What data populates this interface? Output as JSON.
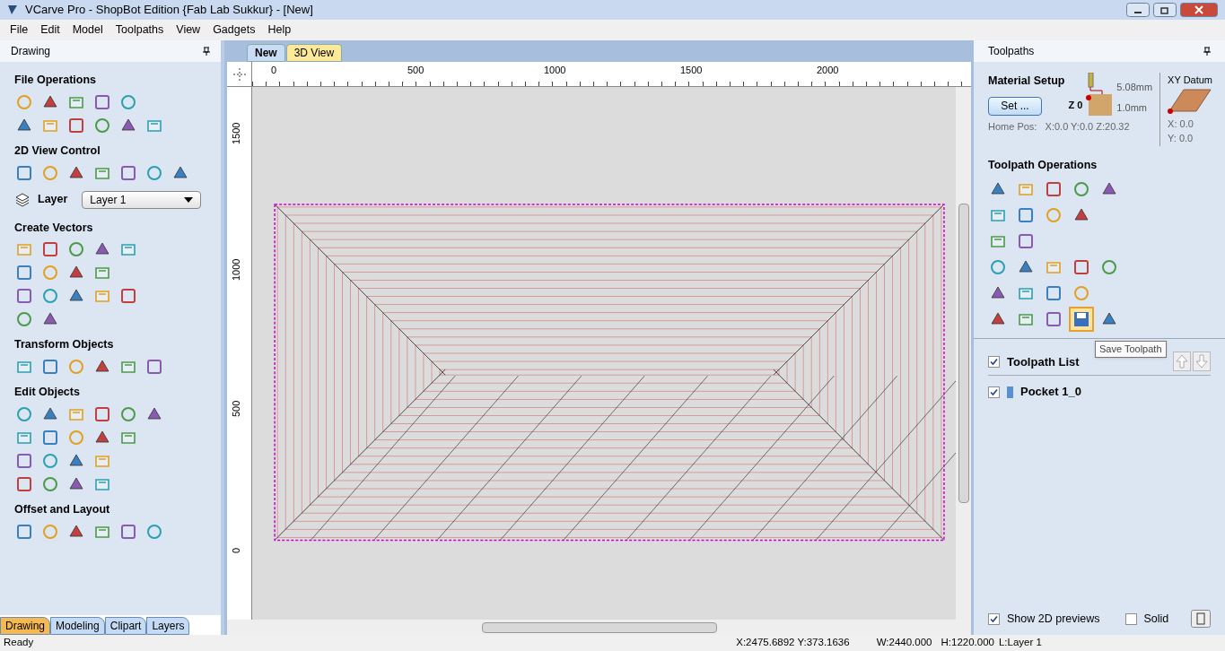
{
  "window": {
    "title": "VCarve Pro - ShopBot Edition {Fab Lab Sukkur} - [New]"
  },
  "menu": [
    "File",
    "Edit",
    "Model",
    "Toolpaths",
    "View",
    "Gadgets",
    "Help"
  ],
  "left_panel": {
    "title": "Drawing",
    "sections": [
      {
        "kind": "icons",
        "title": "File Operations"
      },
      {
        "kind": "icons",
        "title": "2D View Control"
      },
      {
        "kind": "layer",
        "label": "Layer",
        "value": "Layer 1"
      },
      {
        "kind": "icons",
        "title": "Create Vectors"
      },
      {
        "kind": "icons",
        "title": "Transform Objects"
      },
      {
        "kind": "icons",
        "title": "Edit Objects"
      },
      {
        "kind": "icons",
        "title": "Offset and Layout"
      }
    ],
    "tabs": [
      {
        "label": "Drawing",
        "selected": true
      },
      {
        "label": "Modeling",
        "selected": false
      },
      {
        "label": "Clipart",
        "selected": false
      },
      {
        "label": "Layers",
        "selected": false
      }
    ]
  },
  "view_tabs": [
    {
      "label": "New",
      "selected": true
    },
    {
      "label": "3D View",
      "selected": false
    }
  ],
  "ruler": {
    "x_labels": [
      "0",
      "500",
      "1000",
      "1500",
      "2000"
    ],
    "y_labels": [
      "1500",
      "1000",
      "500",
      "0"
    ]
  },
  "right_panel": {
    "title": "Toolpaths",
    "material_setup": {
      "title": "Material Setup",
      "button": "Set ...",
      "z_label": "Z 0",
      "clearance": "5.08mm",
      "offset": "1.0mm",
      "home_pos": "Home Pos:   X:0.0 Y:0.0 Z:20.32",
      "datum_title": "XY Datum",
      "datum_x": "X: 0.0",
      "datum_y": "Y: 0.0"
    },
    "operations_title": "Toolpath Operations",
    "tooltip": "Save Toolpath",
    "toolpath_list": {
      "label": "Toolpath List",
      "checked": true,
      "items": [
        {
          "label": "Pocket 1_0",
          "checked": true
        }
      ]
    },
    "show_previews": {
      "label": "Show 2D previews",
      "checked": true
    },
    "solid": {
      "label": "Solid",
      "checked": false
    }
  },
  "status_bar": {
    "state": "Ready",
    "cursor": "X:2475.6892 Y:373.1636",
    "width": "W:2440.000",
    "height": "H:1220.000",
    "layer": "L:Layer 1"
  }
}
